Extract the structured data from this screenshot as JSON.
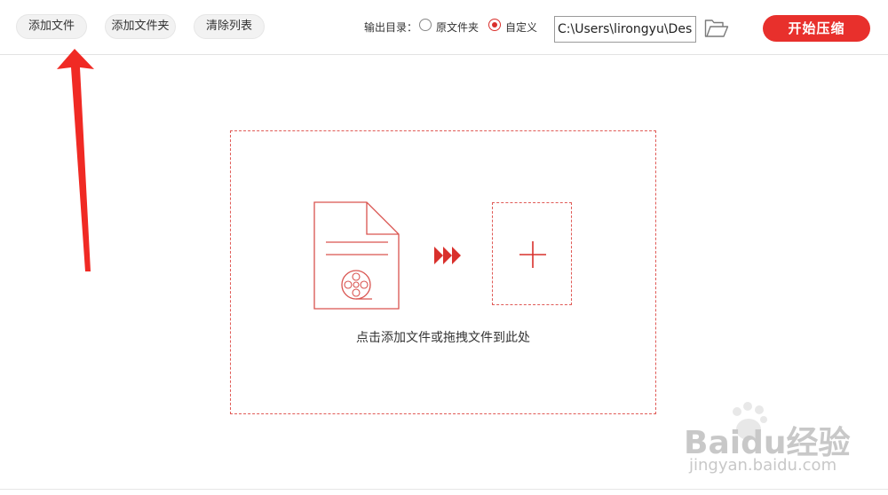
{
  "toolbar": {
    "add_file": "添加文件",
    "add_folder": "添加文件夹",
    "clear_list": "清除列表",
    "output_label": "输出目录：",
    "option_original": "原文件夹",
    "option_custom": "自定义",
    "selected_option": "自定义",
    "output_path": "C:\\Users\\lirongyu\\Desktop",
    "start": "开始压缩"
  },
  "dropzone": {
    "hint": "点击添加文件或拖拽文件到此处"
  },
  "watermark": {
    "brand": "Baidu经验",
    "url": "jingyan.baidu.com"
  },
  "colors": {
    "accent": "#e8302c",
    "dashed": "#e05a56",
    "icon_stroke": "#d9534f"
  },
  "icons": {
    "folder": "folder-open-icon",
    "document": "video-file-icon",
    "arrows": "triple-chevron-right-icon",
    "plus": "plus-icon"
  }
}
